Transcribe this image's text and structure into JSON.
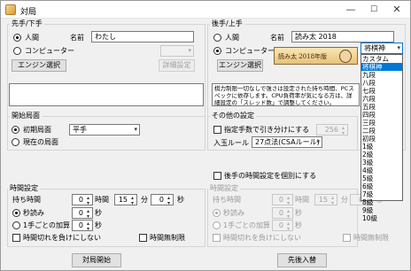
{
  "window": {
    "title": "対局",
    "min": "—",
    "max": "☐",
    "close": "✕"
  },
  "sente": {
    "title": "先手/下手",
    "human": "人間",
    "computer": "コンピューター",
    "name_label": "名前",
    "name_value": "わたし",
    "engine_select": "エンジン選択",
    "detail_settings": "詳細設定"
  },
  "gote": {
    "title": "後手/上手",
    "human": "人間",
    "computer": "コンピューター",
    "name_label": "名前",
    "name_value": "読み太 2018",
    "engine_select": "エンジン選択",
    "engine_banner": "読み太 2018年版",
    "level_value": "将棋神",
    "info_text": "棋力制限一切なしで強さは設定された持ち時間、PCスペックに依存します。CPU負荷率が気になる方は、詳細設定の「スレッド数」で調整してください。"
  },
  "level_options": [
    "カスタム",
    "将棋神",
    "九段",
    "八段",
    "七段",
    "六段",
    "五段",
    "四段",
    "三段",
    "二段",
    "初段",
    "1級",
    "2級",
    "3級",
    "4級",
    "5級",
    "6級",
    "7級",
    "8級",
    "9級",
    "10級"
  ],
  "level_selected_index": 1,
  "start_position": {
    "title": "開始局面",
    "initial": "初期局面",
    "current": "現在の局面",
    "handicap_value": "平手"
  },
  "other_settings": {
    "title": "その他の設定",
    "draw_moves_label": "指定手数で引き分けにする",
    "draw_moves_value": "256",
    "entering_king_label": "入玉ルール",
    "entering_king_value": "27点法(CSAルール)"
  },
  "gote_time_separate": "後手の時間設定を個別にする",
  "time_settings": {
    "title": "時間設定",
    "mochi_label": "持ち時間",
    "hours_value": "0",
    "hours_unit": "時間",
    "minutes_value": "15",
    "minutes_unit": "分",
    "seconds_value": "0",
    "seconds_unit": "秒",
    "byoyomi_label": "秒読み",
    "byoyomi_value": "0",
    "byoyomi_unit": "秒",
    "increment_label": "1手ごとの加算",
    "increment_value": "0",
    "increment_unit": "秒",
    "no_timeout_lose": "時間切れを負けにしない",
    "unlimited": "時間無制限"
  },
  "gote_time_settings": {
    "title": "時間設定",
    "mochi_label": "持ち時間",
    "hours_value": "0",
    "hours_unit": "時間",
    "minutes_value": "15",
    "minutes_unit": "分",
    "seconds_value": "0",
    "seconds_unit": "秒",
    "byoyomi_label": "秒読み",
    "byoyomi_value": "0",
    "byoyomi_unit": "秒",
    "increment_label": "1手ごとの加算",
    "increment_value": "0",
    "increment_unit": "秒",
    "no_timeout_lose": "時間切れを負けにしない",
    "unlimited": "時間無制限"
  },
  "buttons": {
    "start": "対局開始",
    "swap": "先後入替"
  }
}
